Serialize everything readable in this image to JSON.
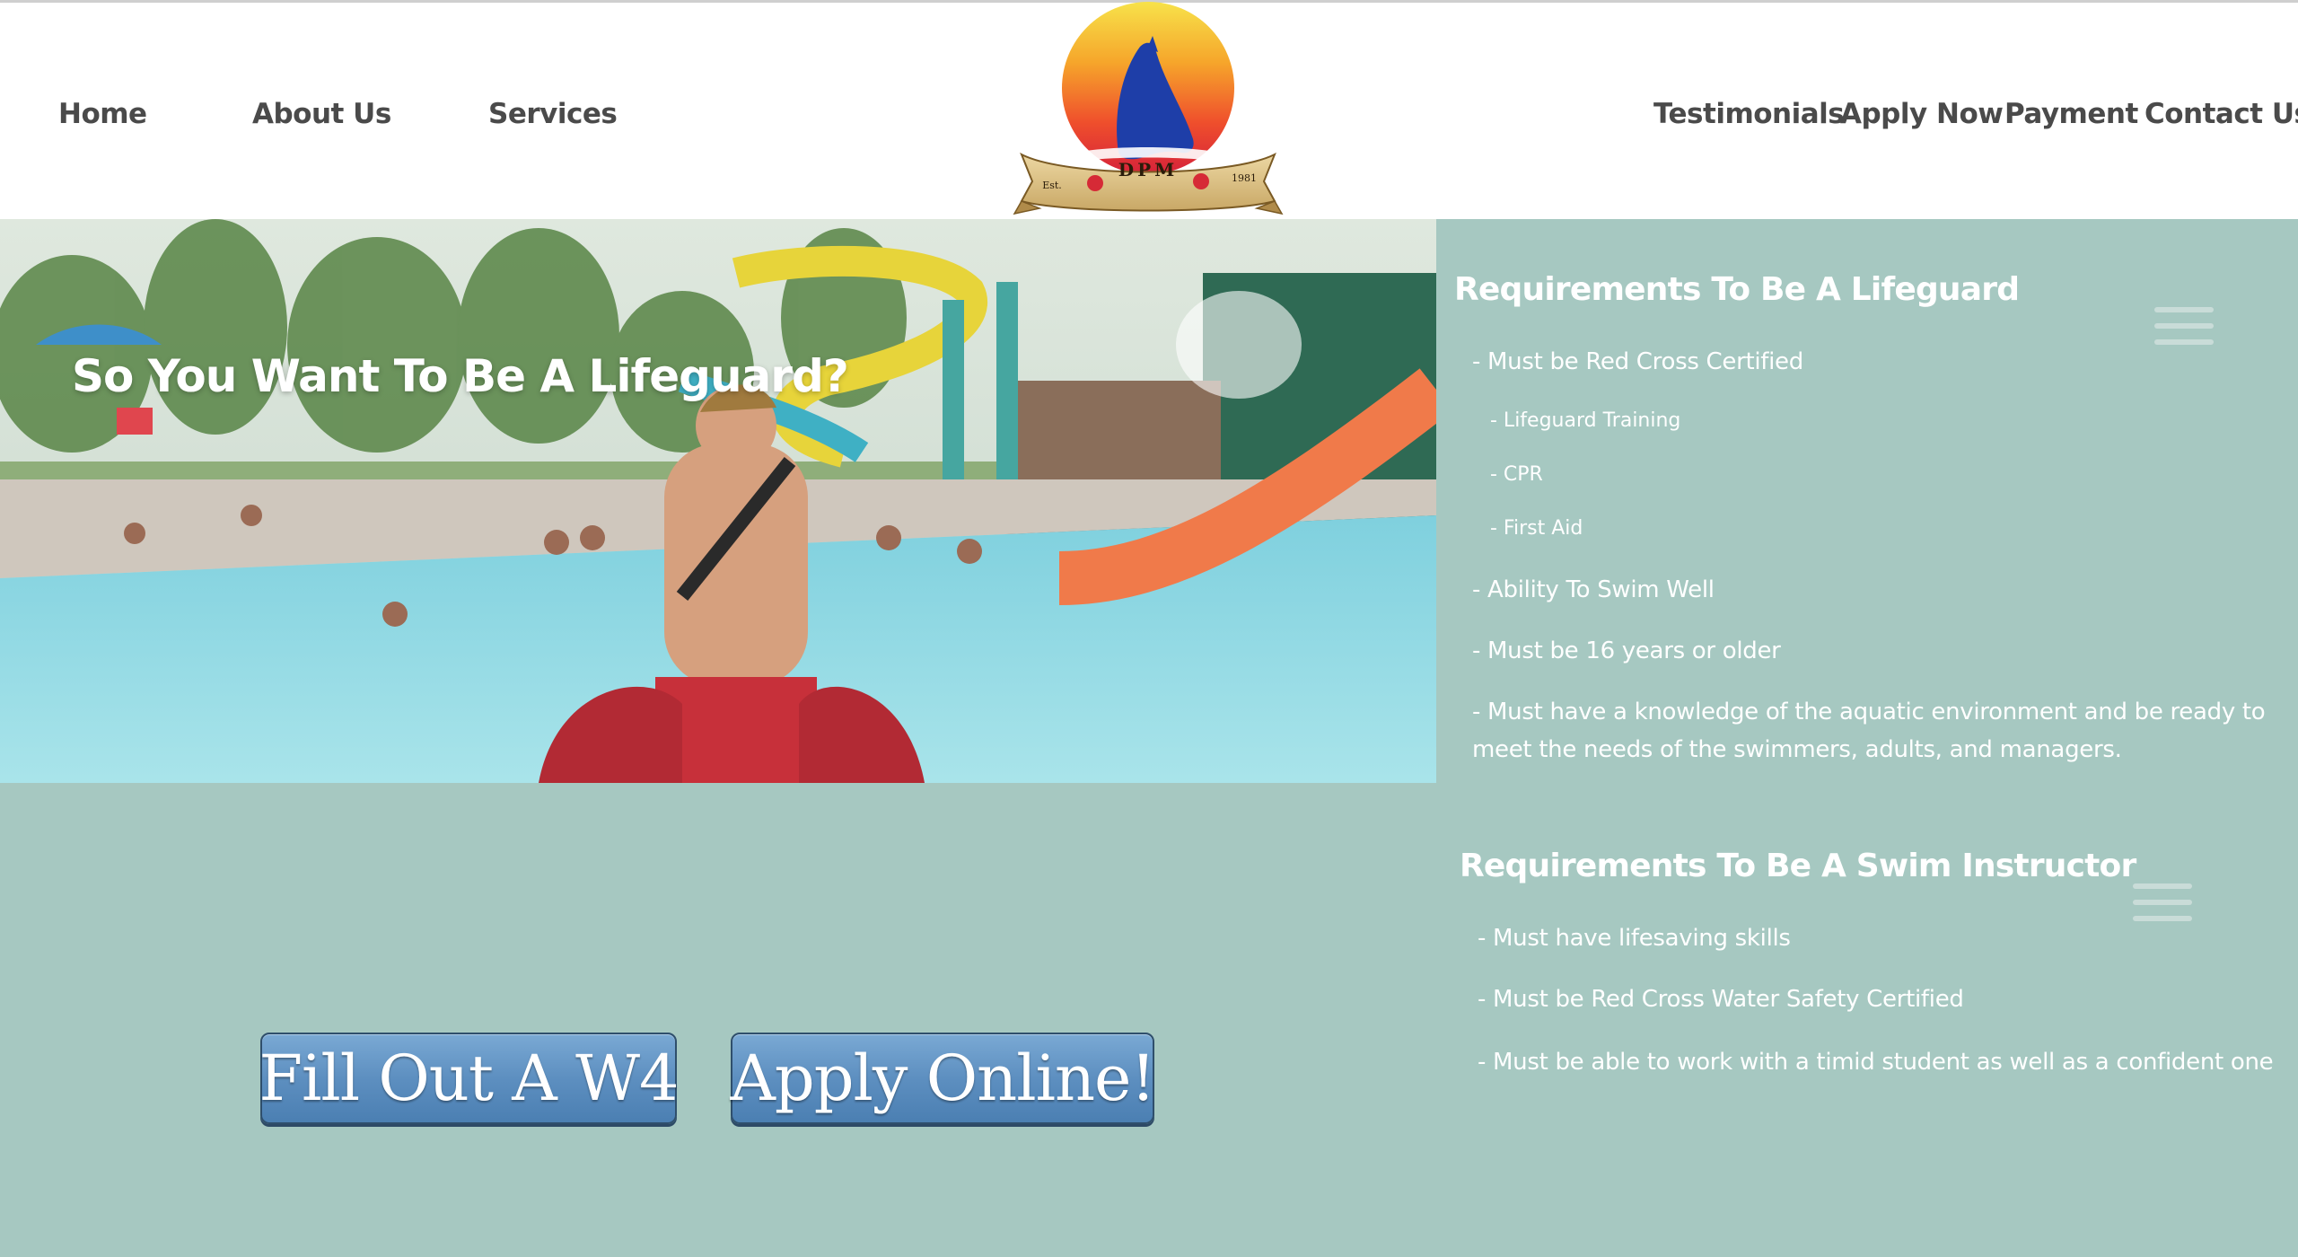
{
  "nav": {
    "home": "Home",
    "about": "About Us",
    "services": "Services",
    "testimonials": "Testimonials",
    "apply_now": "Apply Now",
    "payment": "Payment",
    "contact": "Contact Us"
  },
  "logo": {
    "initials": "DPM",
    "est": "Est.",
    "year": "1981"
  },
  "hero": {
    "title": "So You Want To Be A Lifeguard?"
  },
  "lifeguard": {
    "title": "Requirements To Be A Lifeguard",
    "items": [
      "- Must be Red Cross Certified",
      "- Lifeguard Training",
      "- CPR",
      "- First Aid",
      "- Ability To Swim Well",
      "- Must be 16 years or older",
      "- Must have a knowledge of the aquatic environment and be ready to meet the needs of the swimmers, adults, and managers."
    ]
  },
  "instructor": {
    "title": "Requirements To Be A Swim Instructor",
    "items": [
      "- Must have lifesaving skills",
      "- Must be Red Cross Water Safety Certified",
      "- Must be able to work with a timid student as well as a confident one"
    ]
  },
  "buttons": {
    "w4": "Fill Out A W4",
    "apply": "Apply Online!"
  },
  "icons": {
    "menu": "hamburger-menu-icon"
  },
  "colors": {
    "background": "#a6c8c1",
    "button": "#5d8fc0",
    "nav_text": "#4a4a4a"
  }
}
